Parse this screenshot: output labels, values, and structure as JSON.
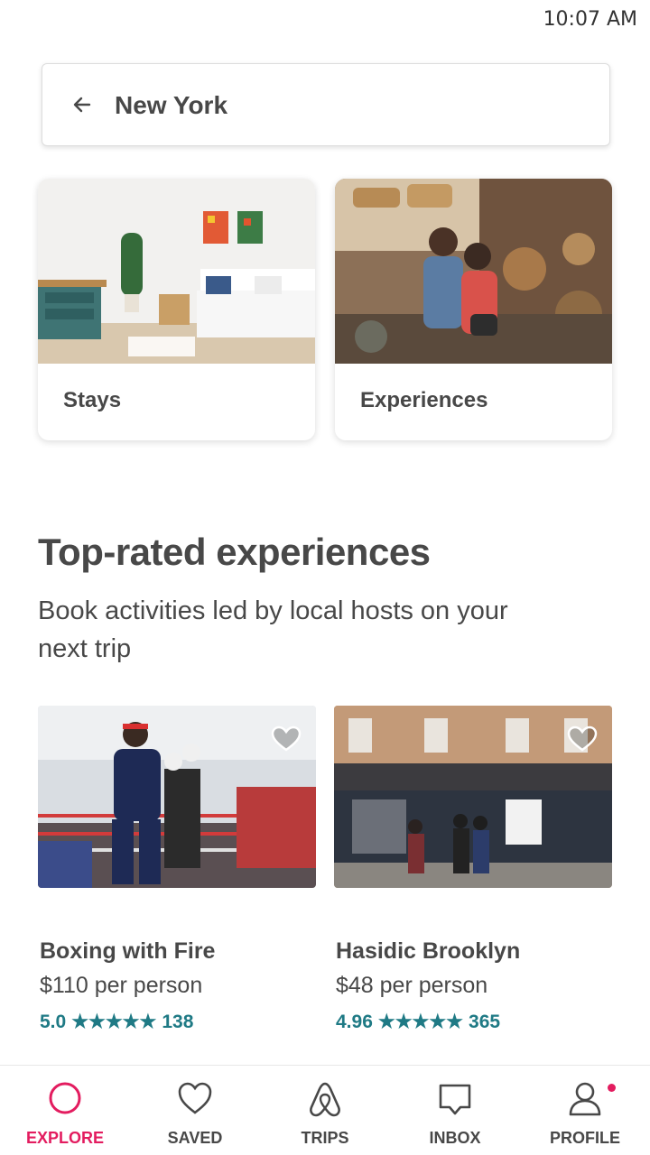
{
  "status_bar": {
    "time": "10:07 AM"
  },
  "search": {
    "value": "New York",
    "back_icon": "arrow-left-icon"
  },
  "categories": [
    {
      "label": "Stays",
      "image": "bedroom-photo"
    },
    {
      "label": "Experiences",
      "image": "cooking-class-photo"
    }
  ],
  "section": {
    "title": "Top-rated experiences",
    "subtitle": "Book activities led by local hosts on your next trip"
  },
  "experiences": [
    {
      "name": "Boxing with Fire",
      "price": "$110 per person",
      "rating": "5.0",
      "stars": "★★★★★",
      "reviews": "138",
      "image": "boxing-gym-photo"
    },
    {
      "name": "Hasidic Brooklyn",
      "price": "$48 per person",
      "rating": "4.96",
      "stars": "★★★★★",
      "reviews": "365",
      "image": "brooklyn-street-photo"
    }
  ],
  "nav": [
    {
      "label": "EXPLORE",
      "icon": "search-icon",
      "active": true
    },
    {
      "label": "SAVED",
      "icon": "heart-icon",
      "active": false
    },
    {
      "label": "TRIPS",
      "icon": "airbnb-logo-icon",
      "active": false
    },
    {
      "label": "INBOX",
      "icon": "message-icon",
      "active": false
    },
    {
      "label": "PROFILE",
      "icon": "user-icon",
      "active": false,
      "badge": true
    }
  ],
  "colors": {
    "accent": "#e31c5f",
    "rating": "#1f7a85",
    "text": "#484848"
  }
}
